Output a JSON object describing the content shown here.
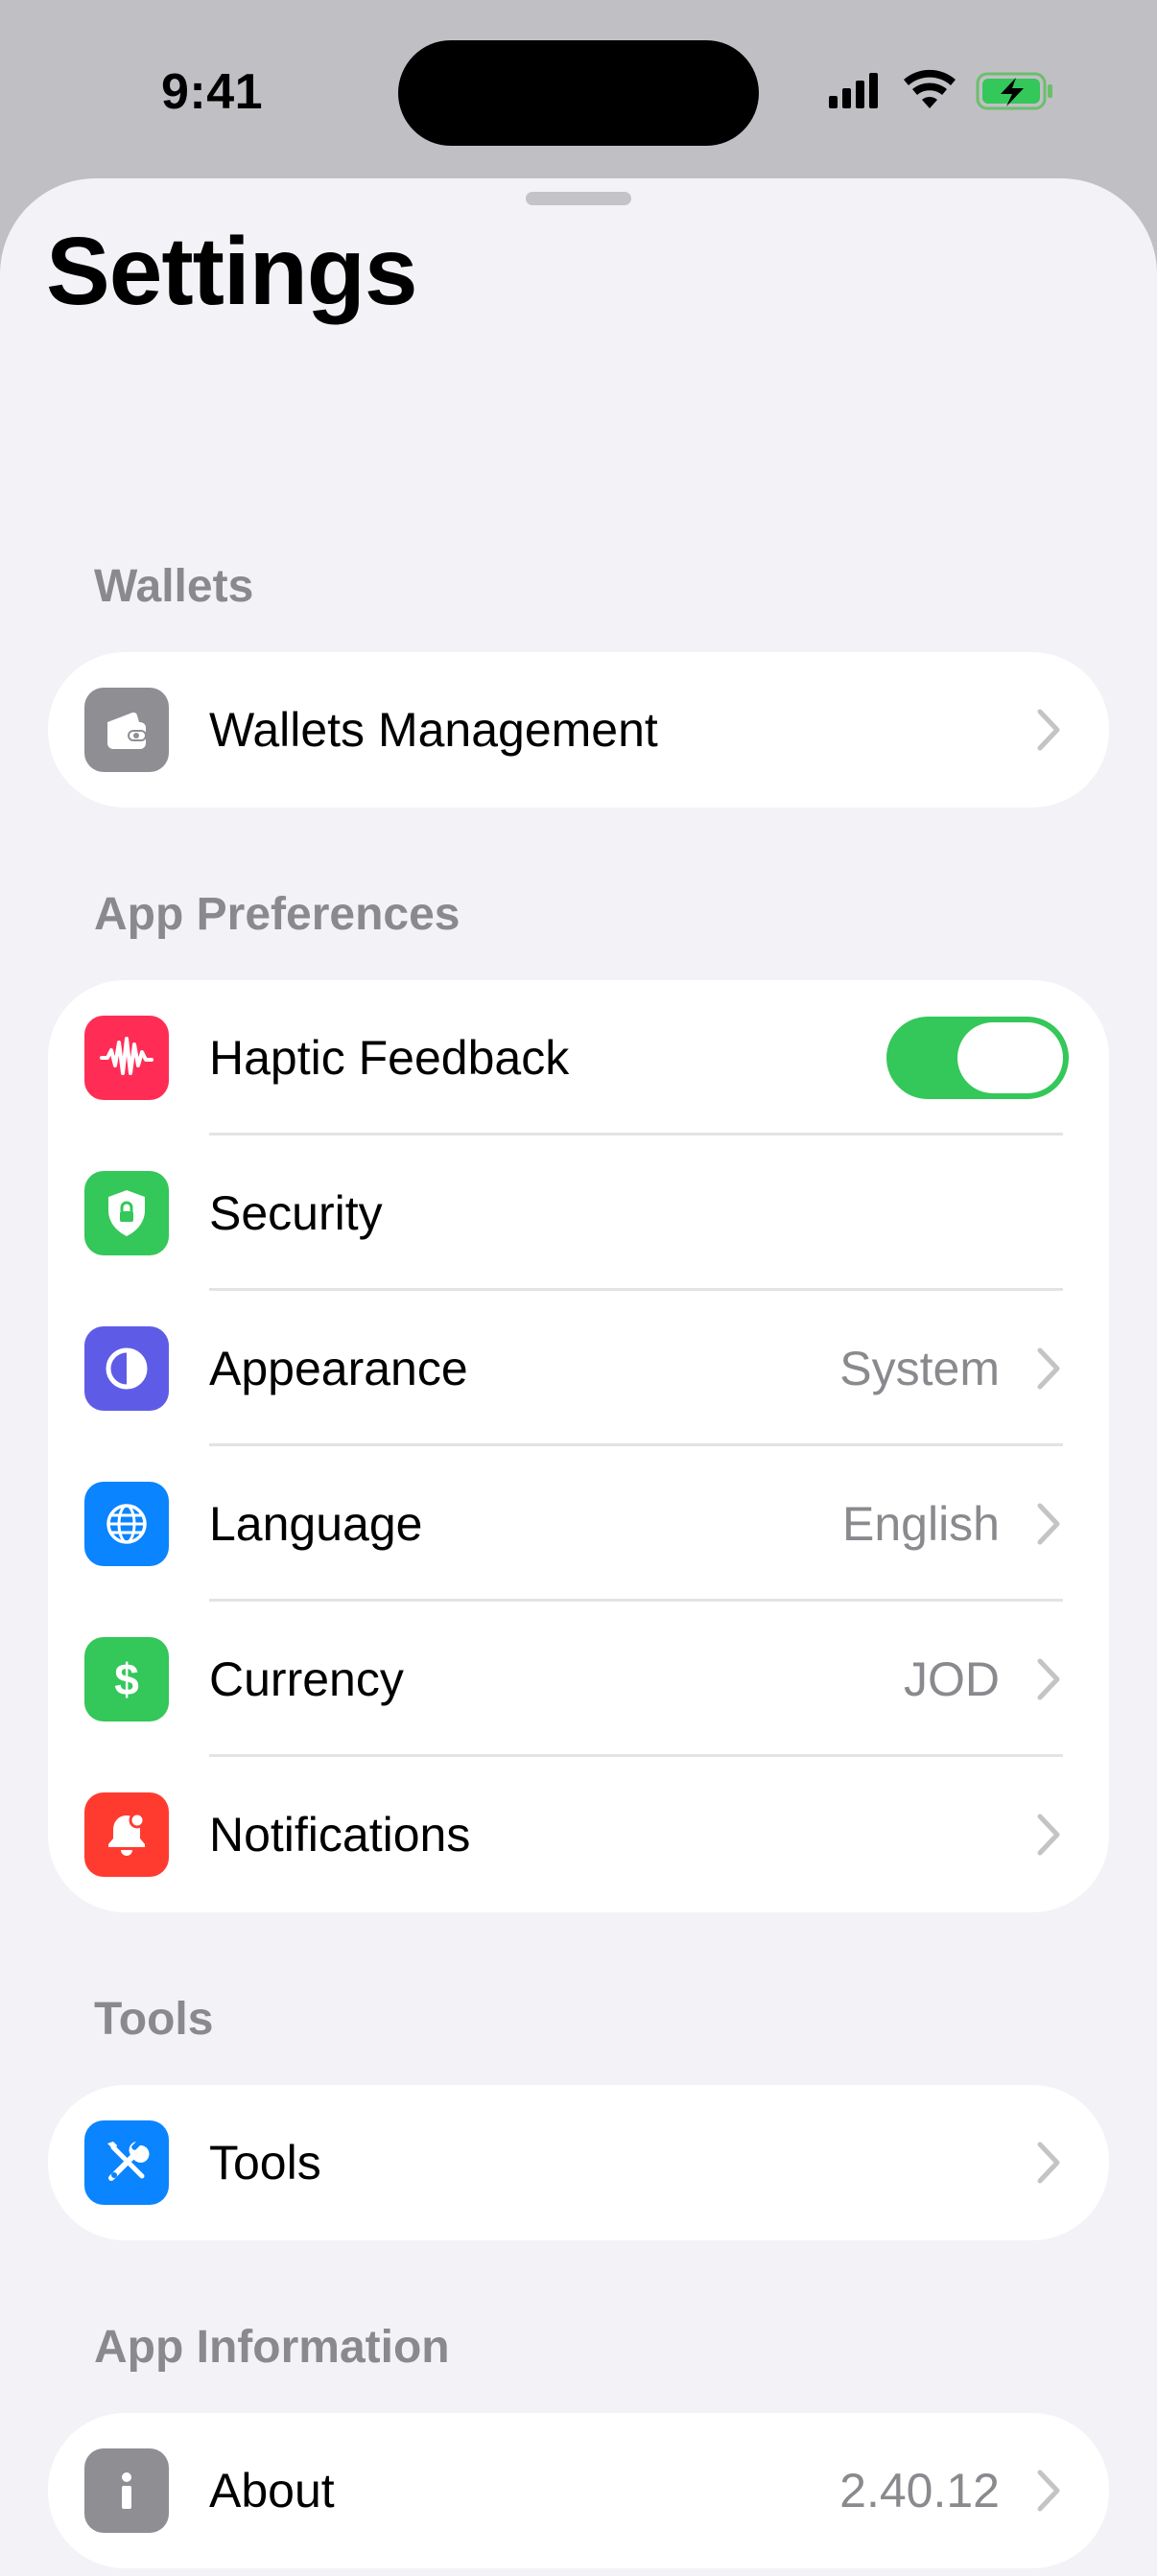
{
  "status_bar": {
    "time": "9:41"
  },
  "page": {
    "title": "Settings"
  },
  "sections": [
    {
      "header": "Wallets",
      "rows": [
        {
          "label": "Wallets Management",
          "icon": "wallet-icon"
        }
      ]
    },
    {
      "header": "App Preferences",
      "rows": [
        {
          "label": "Haptic Feedback",
          "icon": "waveform-icon",
          "toggle_on": true
        },
        {
          "label": "Security",
          "icon": "shield-lock-icon"
        },
        {
          "label": "Appearance",
          "value": "System",
          "icon": "half-circle-icon"
        },
        {
          "label": "Language",
          "value": "English",
          "icon": "globe-icon"
        },
        {
          "label": "Currency",
          "value": "JOD",
          "icon": "dollar-icon"
        },
        {
          "label": "Notifications",
          "icon": "bell-icon"
        }
      ]
    },
    {
      "header": "Tools",
      "rows": [
        {
          "label": "Tools",
          "icon": "wrench-screwdriver-icon"
        }
      ]
    },
    {
      "header": "App Information",
      "rows": [
        {
          "label": "About",
          "value": "2.40.12",
          "icon": "info-icon"
        }
      ]
    }
  ],
  "colors": {
    "accent_green": "#34c759",
    "wallet_icon_bg": "#8e8e93",
    "haptic_icon_bg": "#ff2d55",
    "security_icon_bg": "#34c759",
    "appearance_icon_bg": "#5e5ce6",
    "language_icon_bg": "#0a84ff",
    "currency_icon_bg": "#34c759",
    "notifications_icon_bg": "#ff3b30",
    "tools_icon_bg": "#0a84ff",
    "about_icon_bg": "#8e8e93"
  }
}
